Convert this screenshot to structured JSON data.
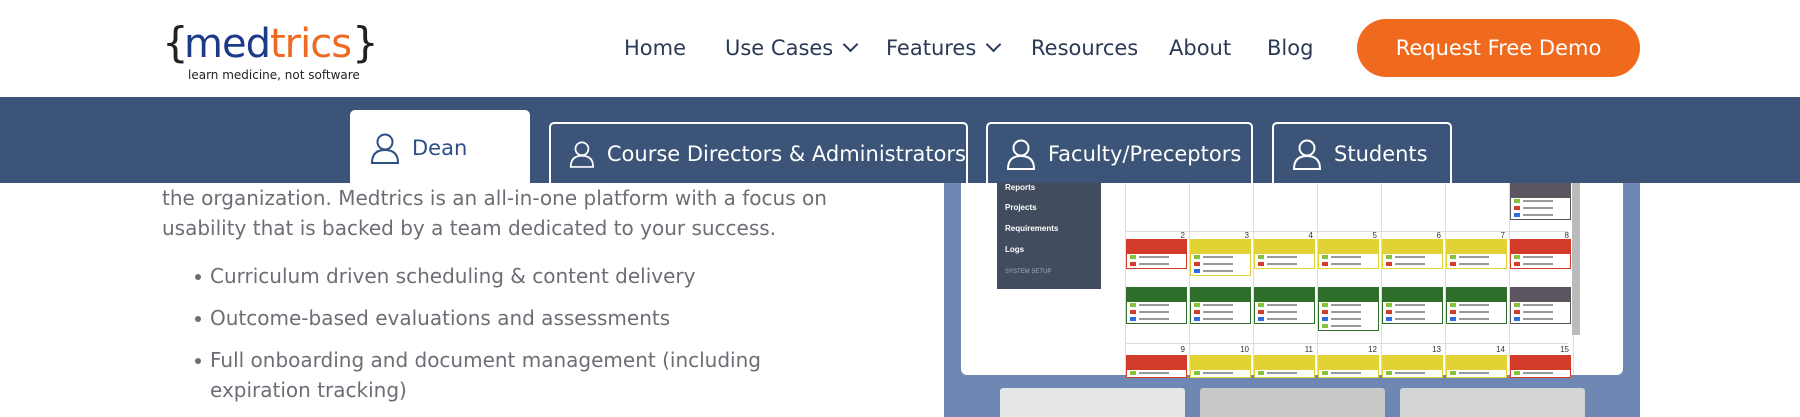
{
  "logo": {
    "word_part1": "med",
    "word_part2": "trics",
    "tagline": "learn medicine, not software",
    "brace_left": "{",
    "brace_right": "}"
  },
  "nav": {
    "home": "Home",
    "use_cases": "Use Cases",
    "features": "Features",
    "resources": "Resources",
    "about": "About",
    "blog": "Blog",
    "cta": "Request Free Demo"
  },
  "tabs": [
    {
      "label": "Dean",
      "active": true
    },
    {
      "label": "Course Directors & Administrators",
      "active": false
    },
    {
      "label": "Faculty/Preceptors",
      "active": false
    },
    {
      "label": "Students",
      "active": false
    }
  ],
  "content": {
    "paragraph_line1": "the organization. Medtrics is an all-in-one platform with a focus on",
    "paragraph_line2": "usability that is backed by a team dedicated to your success.",
    "bullets": [
      "Curriculum driven scheduling & content delivery",
      "Outcome-based evaluations and assessments",
      "Full onboarding and document management (including",
      "expiration tracking)"
    ]
  },
  "screenshot": {
    "sidebar": [
      "Reports",
      "Projects",
      "Requirements",
      "Logs",
      "SYSTEM SETUP"
    ],
    "day_numbers_row1": [
      "2",
      "3",
      "4",
      "5",
      "6",
      "7",
      "8"
    ],
    "day_numbers_row2": [
      "9",
      "10",
      "11",
      "12",
      "13",
      "14",
      "15"
    ]
  },
  "colors": {
    "brand_blue": "#1b3a87",
    "brand_orange": "#ee6a22",
    "band": "#3b5478",
    "cta": "#f06a1e"
  }
}
